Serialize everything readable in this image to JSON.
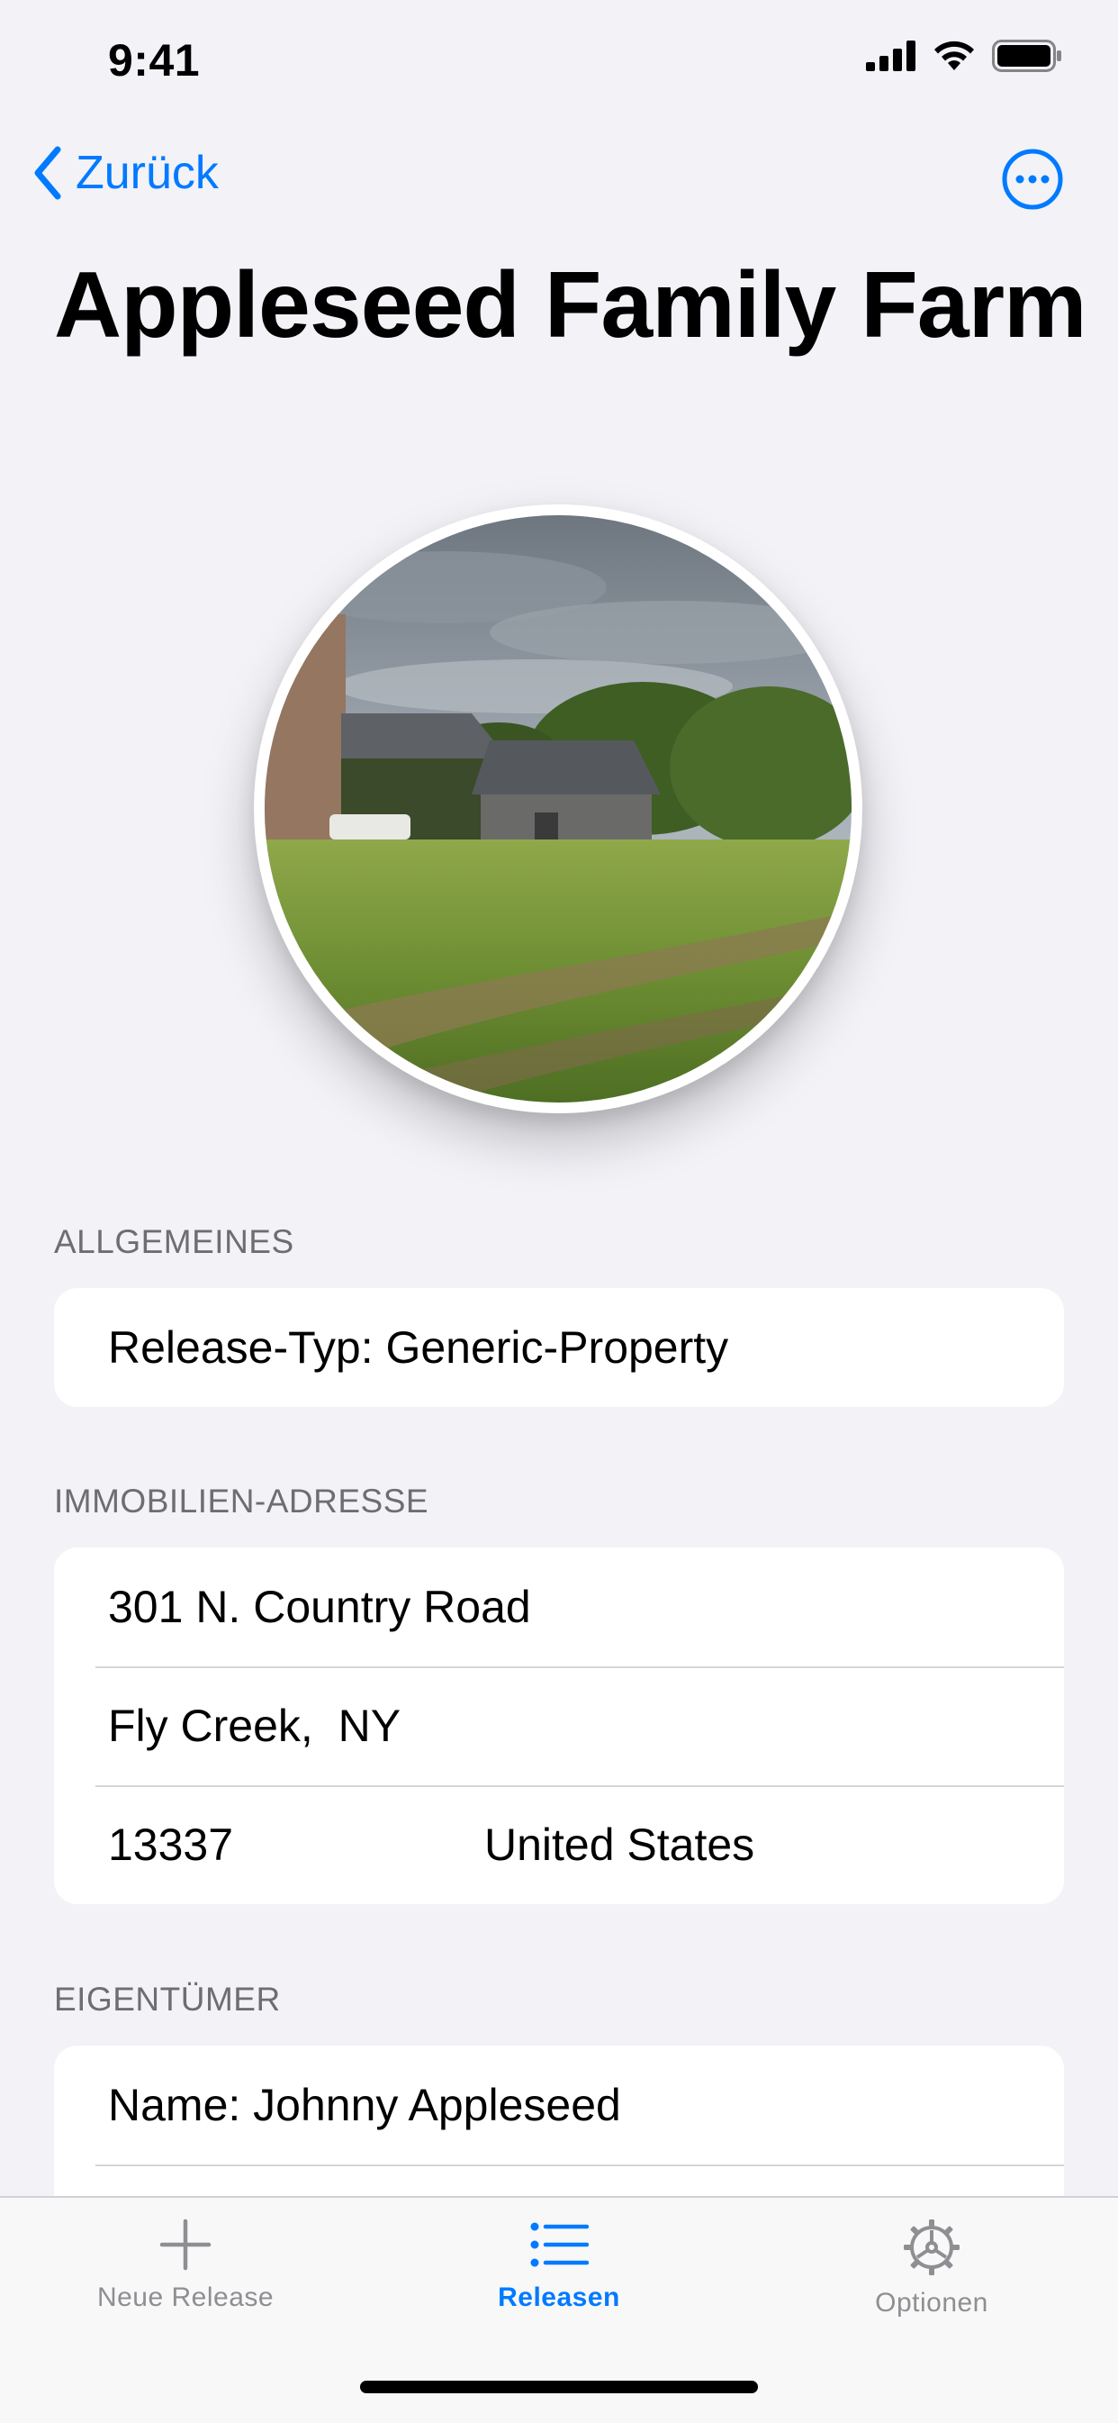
{
  "status_bar": {
    "time": "9:41",
    "icons": [
      "cellular-signal-icon",
      "wifi-icon",
      "battery-icon"
    ]
  },
  "nav": {
    "back_label": "Zurück",
    "more_icon": "ellipsis-circle-icon",
    "title": "Appleseed Family Farm"
  },
  "photo": {
    "description_icon": "farm-photo"
  },
  "sections": {
    "general": {
      "header": "ALLGEMEINES",
      "release_type": "Release-Typ: Generic-Property"
    },
    "address": {
      "header": "IMMOBILIEN-ADRESSE",
      "street": "301 N. Country Road",
      "city_state": "Fly Creek,  NY",
      "zip": "13337",
      "country": "United States"
    },
    "owner": {
      "header": "EIGENTÜMER",
      "name": "Name: Johnny Appleseed"
    }
  },
  "tab_bar": {
    "tabs": [
      {
        "label": "Neue Release",
        "icon": "plus-icon",
        "active": false
      },
      {
        "label": "Releasen",
        "icon": "list-icon",
        "active": true
      },
      {
        "label": "Optionen",
        "icon": "gear-icon",
        "active": false
      }
    ]
  },
  "colors": {
    "accent": "#007AFF",
    "background": "#F2F2F7",
    "inactive_tab": "#8E8E93",
    "section_header": "#6D6D72"
  }
}
